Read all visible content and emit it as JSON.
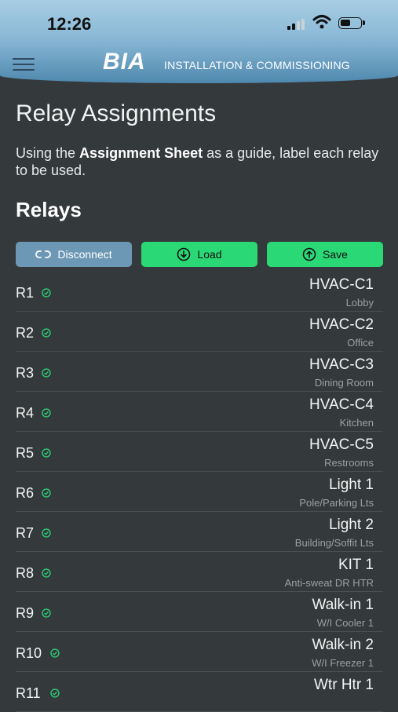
{
  "status_bar": {
    "time": "12:26"
  },
  "header": {
    "logo": "BIA",
    "title": "INSTALLATION & COMMISSIONING"
  },
  "page": {
    "title": "Relay Assignments",
    "instruction_prefix": "Using the ",
    "instruction_bold": "Assignment Sheet",
    "instruction_suffix": " as a guide, label each relay to be used.",
    "section_title": "Relays"
  },
  "buttons": {
    "disconnect": "Disconnect",
    "load": "Load",
    "save": "Save"
  },
  "colors": {
    "accent_green": "#2bd876",
    "accent_blue": "#6c98b5",
    "background": "#34393b"
  },
  "relays": [
    {
      "id": "R1",
      "name": "HVAC-C1",
      "location": "Lobby"
    },
    {
      "id": "R2",
      "name": "HVAC-C2",
      "location": "Office"
    },
    {
      "id": "R3",
      "name": "HVAC-C3",
      "location": "Dining Room"
    },
    {
      "id": "R4",
      "name": "HVAC-C4",
      "location": "Kitchen"
    },
    {
      "id": "R5",
      "name": "HVAC-C5",
      "location": "Restrooms"
    },
    {
      "id": "R6",
      "name": "Light 1",
      "location": "Pole/Parking Lts"
    },
    {
      "id": "R7",
      "name": "Light 2",
      "location": "Building/Soffit Lts"
    },
    {
      "id": "R8",
      "name": "KIT 1",
      "location": "Anti-sweat DR HTR"
    },
    {
      "id": "R9",
      "name": "Walk-in 1",
      "location": "W/I Cooler 1"
    },
    {
      "id": "R10",
      "name": "Walk-in 2",
      "location": "W/I Freezer 1"
    },
    {
      "id": "R11",
      "name": "Wtr Htr 1",
      "location": ""
    }
  ]
}
